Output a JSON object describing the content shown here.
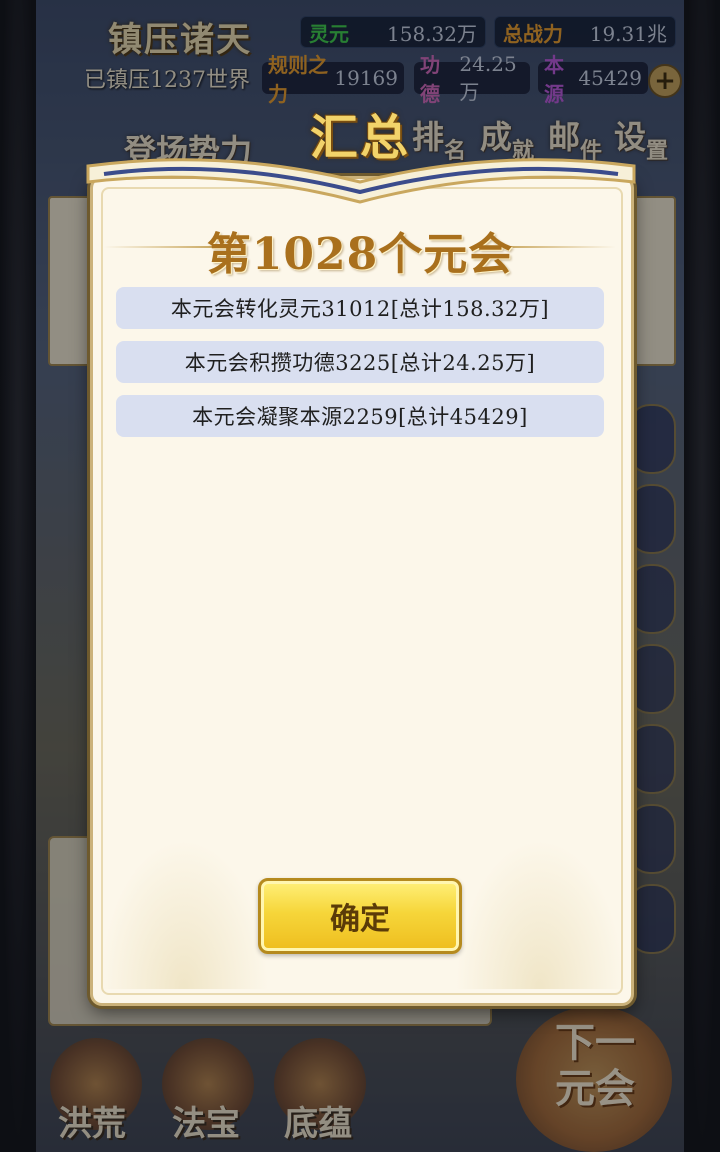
{
  "header": {
    "game_title": "镇压诸天",
    "stats": [
      {
        "key": "灵元",
        "value": "158.32万",
        "key_color": "#3ed24a"
      },
      {
        "key": "总战力",
        "value": "19.31兆",
        "key_color": "#f0a12a"
      }
    ],
    "suppressed_worlds": "已镇压1237世界",
    "resources": [
      {
        "key": "规则之力",
        "value": "19169",
        "key_color": "#f0a12a"
      },
      {
        "key": "功德",
        "value": "24.25万",
        "key_color": "#d86cc0"
      },
      {
        "key": "本源",
        "value": "45429",
        "key_color": "#c05ae0"
      }
    ],
    "add_icon": "plus-icon"
  },
  "menu": {
    "items": [
      "登场势力",
      "排",
      "名",
      "成",
      "就",
      "邮",
      "件",
      "设",
      "置"
    ]
  },
  "modal": {
    "summary_title": "汇总",
    "epoch_title": "第1028个元会",
    "lines": [
      "本元会转化灵元31012[总计158.32万]",
      "本元会积攒功德3225[总计24.25万]",
      "本元会凝聚本源2259[总计45429]"
    ],
    "confirm_label": "确定"
  },
  "bottom": {
    "tabs": [
      "洪荒",
      "法宝",
      "底蕴"
    ],
    "next_label_1": "下一",
    "next_label_2": "元会"
  },
  "colors": {
    "modal_bg": "#fcf7ea",
    "line_bg": "#d9dff0",
    "title_gold": "#a9701d",
    "button_yellow": "#f6d63a"
  }
}
